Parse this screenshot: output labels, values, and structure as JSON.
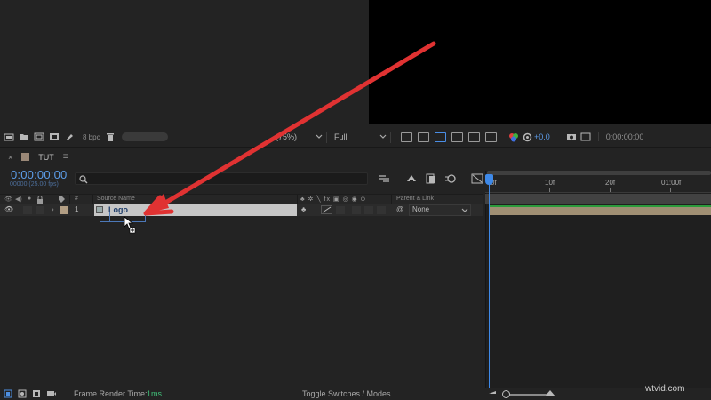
{
  "project_panel": {
    "bpc_label": "8 bpc"
  },
  "viewer_footer": {
    "zoom_value": "(75%)",
    "resolution_value": "Full",
    "exposure_offset": "+0.0",
    "timecode": "0:00:00:00"
  },
  "timeline": {
    "tab_label": "TUT",
    "current_time": "0:00:00:00",
    "fps_sub": "00000 (25.00 fps)",
    "search_placeholder": "",
    "headers": {
      "number": "#",
      "source_name": "Source Name",
      "parent_link": "Parent & Link"
    },
    "layer": {
      "number": "1",
      "name": "Logo",
      "parent": "None"
    },
    "ruler_labels": [
      "0f",
      "10f",
      "20f",
      "01:00f"
    ]
  },
  "status_bar": {
    "render_time_label": "Frame Render Time:",
    "render_time_value": "1ms",
    "toggle_label": "Toggle Switches / Modes"
  },
  "watermark": "wtvid.com",
  "colors": {
    "accent_blue": "#3e89e8",
    "arrow_red": "#e03232",
    "layer_label": "#b29e84",
    "render_green": "#40c27a"
  }
}
